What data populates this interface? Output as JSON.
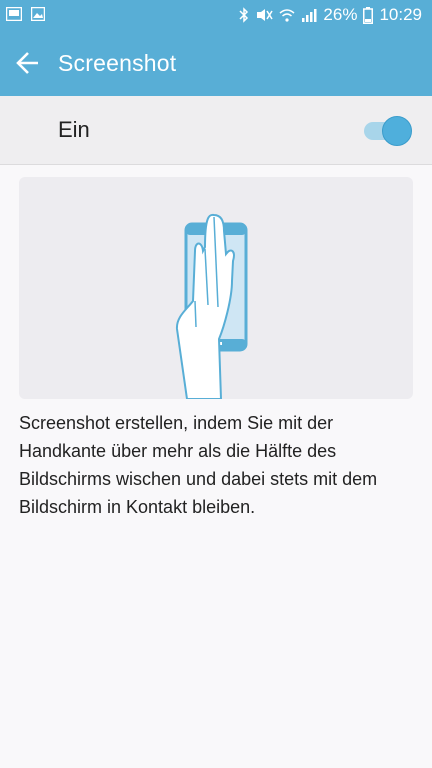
{
  "status_bar": {
    "icons_left": [
      "gallery-notification-icon",
      "image-notification-icon"
    ],
    "icons_right": [
      "bluetooth-icon",
      "mute-icon",
      "wifi-icon",
      "signal-icon",
      "battery-icon"
    ],
    "battery_percent": "26%",
    "time": "10:29"
  },
  "app_bar": {
    "title": "Screenshot",
    "back_icon": "back-arrow-icon"
  },
  "toggle": {
    "label": "Ein",
    "state": "on",
    "accent_color": "#4fafdc"
  },
  "illustration": {
    "icon": "palm-swipe-phone-illustration"
  },
  "description": "Screenshot erstellen, indem Sie mit der Handkante über mehr als die Hälfte des Bildschirms wischen und dabei stets mit dem Bildschirm in Kontakt bleiben.",
  "colors": {
    "app_bar": "#58aed6",
    "background": "#f9f8fa",
    "toggle_row": "#efeef0"
  }
}
